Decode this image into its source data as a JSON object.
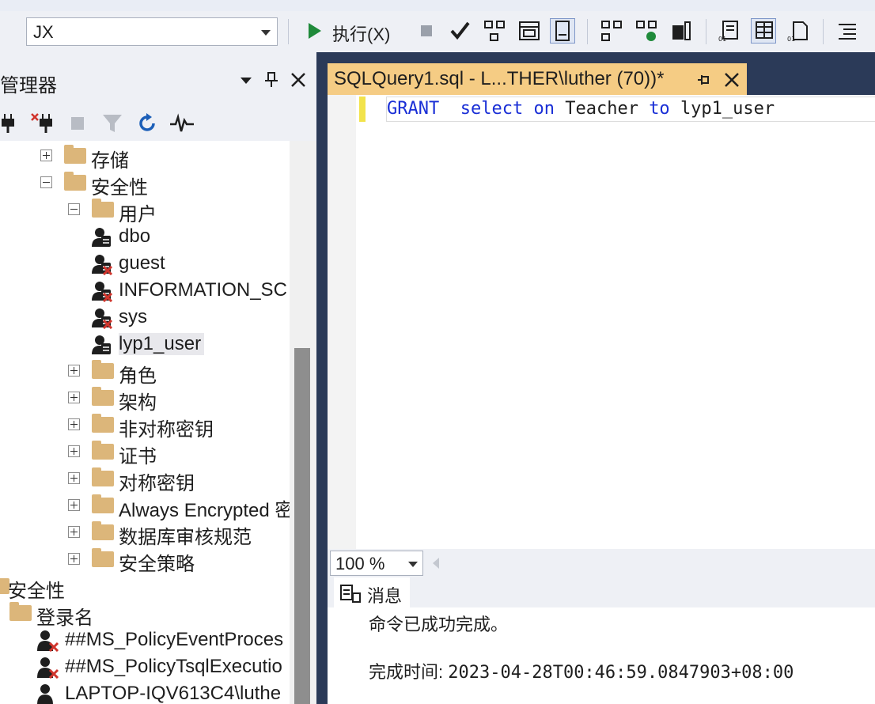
{
  "toolbar": {
    "database": "JX",
    "execute_label": "执行(X)"
  },
  "object_explorer": {
    "title": "管理器",
    "tree": [
      {
        "label": "存储",
        "kind": "folder",
        "indent": 1,
        "expander": "plus"
      },
      {
        "label": "安全性",
        "kind": "folder",
        "indent": 1,
        "expander": "minus"
      },
      {
        "label": "用户",
        "kind": "folder",
        "indent": 2,
        "expander": "minus"
      },
      {
        "label": "dbo",
        "kind": "user",
        "indent": 3,
        "expander": "none"
      },
      {
        "label": "guest",
        "kind": "user-disabled",
        "indent": 3,
        "expander": "none"
      },
      {
        "label": "INFORMATION_SC",
        "kind": "user-disabled",
        "indent": 3,
        "expander": "none"
      },
      {
        "label": "sys",
        "kind": "user-disabled",
        "indent": 3,
        "expander": "none"
      },
      {
        "label": "lyp1_user",
        "kind": "user",
        "indent": 3,
        "expander": "none",
        "selected": true
      },
      {
        "label": "角色",
        "kind": "folder",
        "indent": 2,
        "expander": "plus"
      },
      {
        "label": "架构",
        "kind": "folder",
        "indent": 2,
        "expander": "plus"
      },
      {
        "label": "非对称密钥",
        "kind": "folder",
        "indent": 2,
        "expander": "plus"
      },
      {
        "label": "证书",
        "kind": "folder",
        "indent": 2,
        "expander": "plus"
      },
      {
        "label": "对称密钥",
        "kind": "folder",
        "indent": 2,
        "expander": "plus"
      },
      {
        "label": "Always Encrypted 密钥",
        "kind": "folder",
        "indent": 2,
        "expander": "plus"
      },
      {
        "label": "数据库审核规范",
        "kind": "folder",
        "indent": 2,
        "expander": "plus"
      },
      {
        "label": "安全策略",
        "kind": "folder",
        "indent": 2,
        "expander": "plus"
      },
      {
        "label": "安全性",
        "kind": "folder",
        "indent": 0,
        "expander": "none"
      },
      {
        "label": "登录名",
        "kind": "folder",
        "indent": 0.5,
        "expander": "none"
      },
      {
        "label": "##MS_PolicyEventProces",
        "kind": "login-disabled",
        "indent": 1.4,
        "expander": "none"
      },
      {
        "label": "##MS_PolicyTsqlExecutio",
        "kind": "login-disabled",
        "indent": 1.4,
        "expander": "none"
      },
      {
        "label": "LAPTOP-IQV613C4\\luthe",
        "kind": "login",
        "indent": 1.4,
        "expander": "none"
      }
    ]
  },
  "editor": {
    "tab_title": "SQLQuery1.sql - L...THER\\luther (70))*",
    "code": {
      "grant": "GRANT",
      "select": "select",
      "on": "on",
      "table": "Teacher",
      "to": "to",
      "user": "lyp1_user"
    },
    "zoom": "100 %"
  },
  "results": {
    "tab_label": "消息",
    "line1": "命令已成功完成。",
    "time_label": "完成时间:",
    "time_value": "2023-04-28T00:46:59.0847903+08:00"
  },
  "colors": {
    "keyword": "#1a2fd6",
    "tab_active": "#f5cc84",
    "folder": "#dcb67a",
    "chrome_dark": "#2b3a58"
  }
}
